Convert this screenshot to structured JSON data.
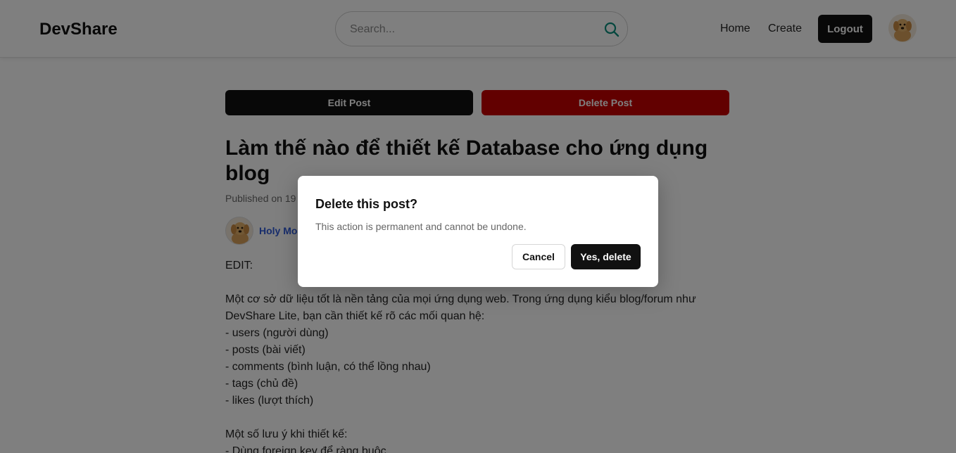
{
  "header": {
    "logo": "DevShare",
    "search_placeholder": "Search...",
    "nav": {
      "home": "Home",
      "create": "Create"
    },
    "logout_label": "Logout",
    "accent_color": "#0b8f7c"
  },
  "post": {
    "edit_label": "Edit Post",
    "delete_label": "Delete Post",
    "title": "Làm thế nào để thiết kế Database cho ứng dụng blog",
    "meta": "Published on 19",
    "author": "Holy Mo",
    "body_lines": [
      "EDIT:",
      "",
      "Một cơ sở dữ liệu tốt là nền tảng của mọi ứng dụng web. Trong ứng dụng kiểu blog/forum như",
      "DevShare Lite, bạn cần thiết kế rõ các mối quan hệ:",
      "- users (người dùng)",
      "- posts (bài viết)",
      "- comments (bình luận, có thể lồng nhau)",
      "- tags (chủ đề)",
      "- likes (lượt thích)",
      "",
      "Một số lưu ý khi thiết kế:",
      "- Dùng foreign key để ràng buộc"
    ]
  },
  "modal": {
    "title": "Delete this post?",
    "message": "This action is permanent and cannot be undone.",
    "cancel_label": "Cancel",
    "confirm_label": "Yes, delete"
  }
}
